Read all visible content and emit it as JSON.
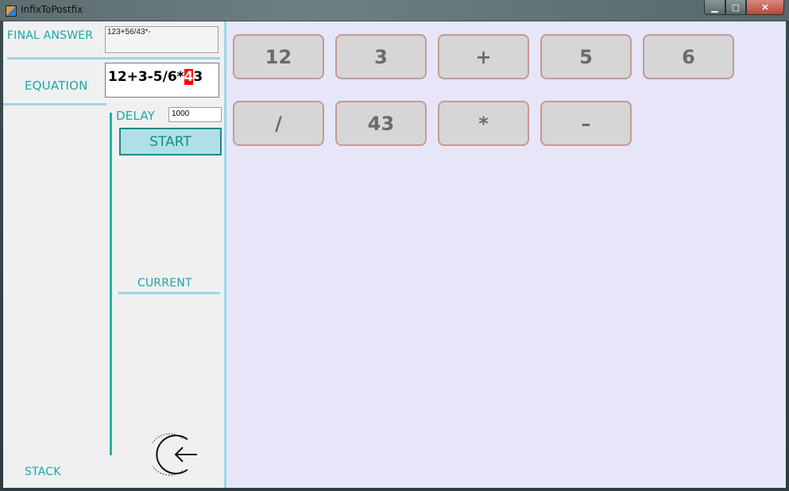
{
  "window": {
    "title": "InfixToPostfix",
    "minimize_label": "▁",
    "maximize_label": "▢",
    "close_label": "✕"
  },
  "panel": {
    "final_answer_label": "FINAL ANSWER",
    "final_answer_value": "123+56/43*-",
    "equation_label": "EQUATION",
    "equation_before": "12+3-5/6*",
    "equation_highlight": "4",
    "equation_after": "3",
    "delay_label": "DELAY",
    "delay_value": "1000",
    "start_label": "START",
    "current_label": "CURRENT",
    "stack_label": "STACK"
  },
  "tokens": {
    "row1": [
      "12",
      "3",
      "+",
      "5",
      "6"
    ],
    "row2": [
      "/",
      "43",
      "*",
      "–"
    ]
  },
  "colors": {
    "accent": "#1aa7a7",
    "separator": "#9dd4e6",
    "stage_bg": "#e6e6f8",
    "highlight": "#ff0000"
  },
  "icons": {
    "back": "back-arrow-circle-icon"
  }
}
